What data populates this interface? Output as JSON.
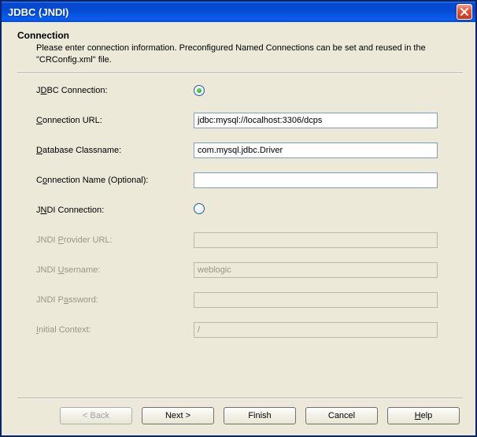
{
  "window": {
    "title": "JDBC (JNDI)"
  },
  "section": {
    "title": "Connection",
    "description": "Please enter connection information. Preconfigured Named Connections can be set and reused in the \"CRConfig.xml\" file."
  },
  "form": {
    "jdbc_connection": {
      "label_pre": "J",
      "label_u": "D",
      "label_post": "BC Connection:",
      "selected": true
    },
    "connection_url": {
      "label_u": "C",
      "label_post": "onnection URL:",
      "value": "jdbc:mysql://localhost:3306/dcps"
    },
    "database_classname": {
      "label_u": "D",
      "label_post": "atabase Classname:",
      "value": "com.mysql.jdbc.Driver"
    },
    "connection_name": {
      "label_pre": "C",
      "label_u": "o",
      "label_post": "nnection Name (Optional):",
      "value": ""
    },
    "jndi_connection": {
      "label_pre": "J",
      "label_u": "N",
      "label_post": "DI Connection:",
      "selected": false
    },
    "jndi_provider_url": {
      "label_pre": "JNDI ",
      "label_u": "P",
      "label_post": "rovider URL:",
      "value": ""
    },
    "jndi_username": {
      "label_pre": "JNDI ",
      "label_u": "U",
      "label_post": "sername:",
      "value": "weblogic"
    },
    "jndi_password": {
      "label_pre": "JNDI P",
      "label_u": "a",
      "label_post": "ssword:",
      "value": ""
    },
    "initial_context": {
      "label_u": "I",
      "label_post": "nitial Context:",
      "value": "/"
    }
  },
  "buttons": {
    "back": "< Back",
    "next": "Next >",
    "finish": "Finish",
    "cancel": "Cancel",
    "help_u": "H",
    "help_post": "elp"
  }
}
